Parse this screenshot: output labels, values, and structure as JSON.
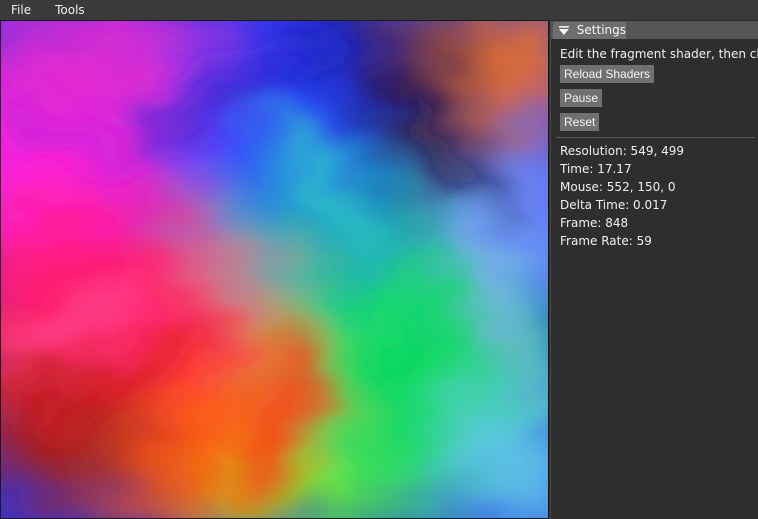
{
  "menubar": {
    "items": [
      {
        "label": "File"
      },
      {
        "label": "Tools"
      }
    ]
  },
  "panel": {
    "title": "Settings",
    "instruction": "Edit the fragment shader, then click:",
    "buttons": {
      "reload": "Reload Shaders",
      "pause": "Pause",
      "reset": "Reset"
    },
    "stats": {
      "resolution": "Resolution: 549, 499",
      "time": "Time: 17.17",
      "mouse": "Mouse: 552, 150, 0",
      "delta_time": "Delta Time: 0.017",
      "frame": "Frame: 848",
      "frame_rate": "Frame Rate: 59"
    }
  },
  "colors": {
    "menubar_bg": "#3a3a3a",
    "panel_bg": "#2e2e2e",
    "panel_header_bg": "#555555",
    "button_bg": "#707070",
    "text": "#f0f0f0"
  },
  "icons": {
    "collapse": "triangle-down-icon"
  }
}
